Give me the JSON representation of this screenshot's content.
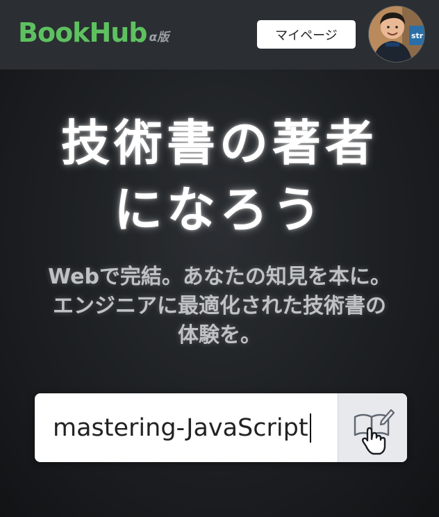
{
  "header": {
    "logo_text": "BookHub",
    "logo_badge": "α版",
    "mypage_label": "マイページ",
    "avatar_icon": "user-avatar"
  },
  "hero": {
    "headline_line1": "技術書の著者",
    "headline_line2": "になろう",
    "sub_line1": "Webで完結。あなたの知見を本に。",
    "sub_line2": "エンジニアに最適化された技術書の",
    "sub_line3": "体験を。"
  },
  "search": {
    "value": "mastering-JavaScript",
    "button_icon": "open-book-pen-icon",
    "cursor_icon": "hand-pointer-icon"
  },
  "colors": {
    "brand": "#5ec160",
    "header_bg": "#2b2f33",
    "page_bg": "#1b1d20"
  }
}
